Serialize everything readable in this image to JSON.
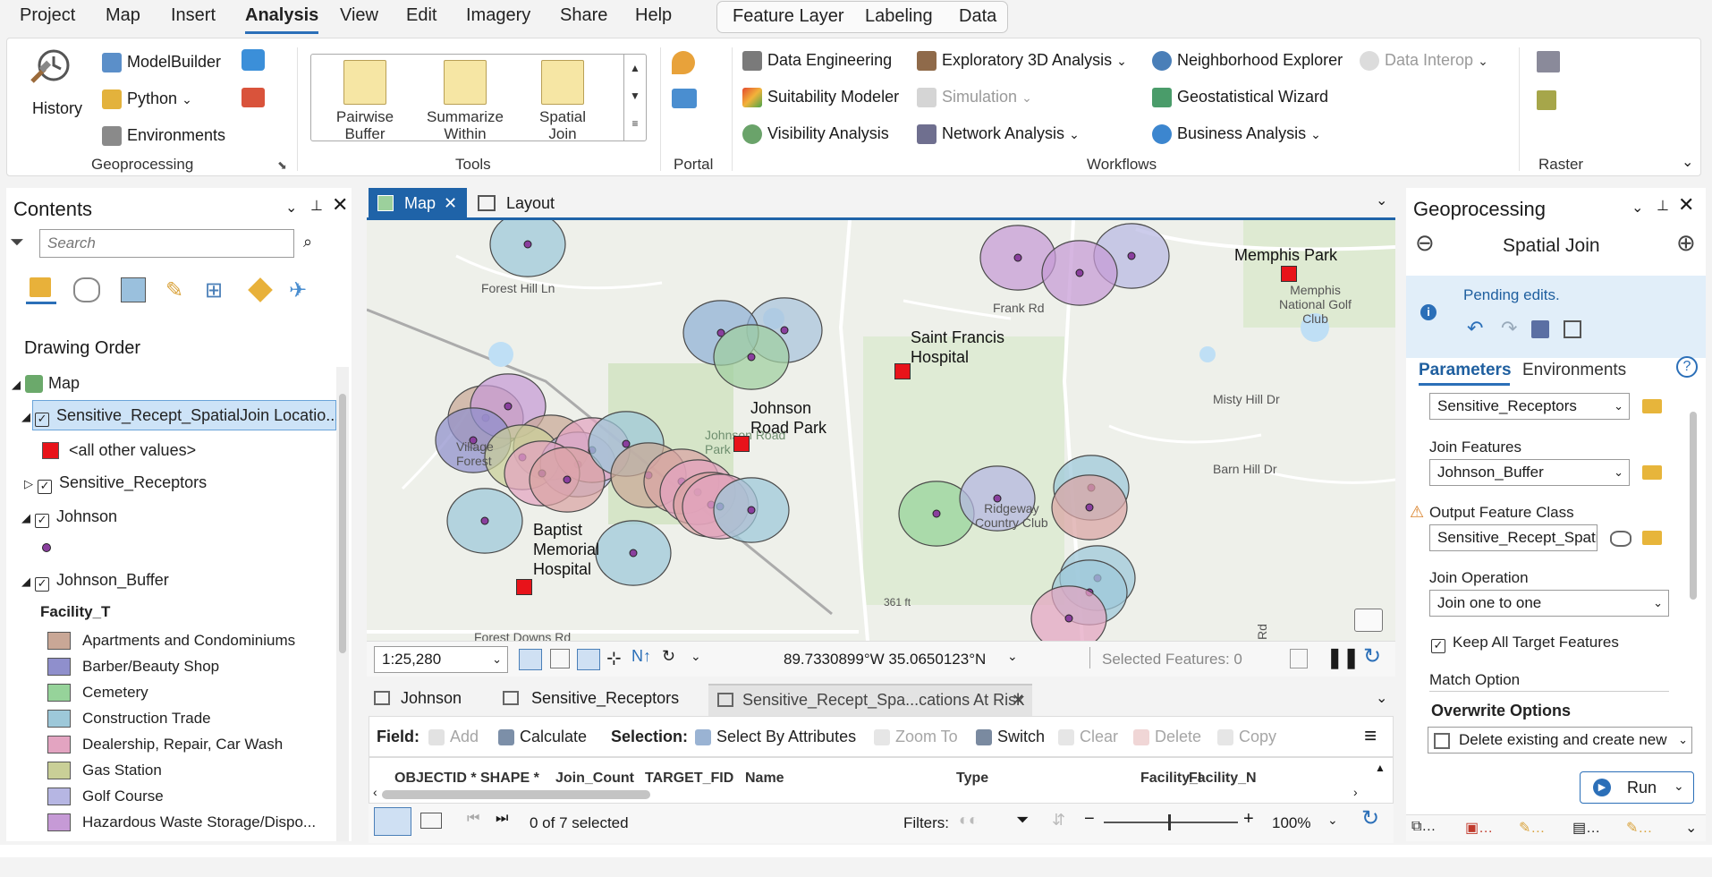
{
  "menu": {
    "tabs": [
      "Project",
      "Map",
      "Insert",
      "Analysis",
      "View",
      "Edit",
      "Imagery",
      "Share",
      "Help"
    ],
    "active": "Analysis",
    "context_tabs": [
      "Feature Layer",
      "Labeling",
      "Data"
    ]
  },
  "ribbon": {
    "history": "History",
    "modelbuilder": "ModelBuilder",
    "python": "Python",
    "environments": "Environments",
    "geoprocessing_group": "Geoprocessing",
    "tools": [
      "Pairwise Buffer",
      "Summarize Within",
      "Spatial Join"
    ],
    "tools_group": "Tools",
    "portal_group": "Portal",
    "workflows": {
      "data_engineering": "Data Engineering",
      "suitability_modeler": "Suitability Modeler",
      "visibility_analysis": "Visibility Analysis",
      "exploratory_3d": "Exploratory 3D Analysis",
      "simulation": "Simulation",
      "network_analysis": "Network Analysis",
      "neighborhood_explorer": "Neighborhood Explorer",
      "geostatistical_wizard": "Geostatistical Wizard",
      "business_analysis": "Business Analysis",
      "data_interop": "Data Interop"
    },
    "workflows_group": "Workflows",
    "raster_group": "Raster"
  },
  "contents": {
    "title": "Contents",
    "search_placeholder": "Search",
    "drawing_order": "Drawing Order",
    "map": "Map",
    "layers": {
      "spatialjoin": "Sensitive_Recept_SpatialJoin Locatio...",
      "all_other": "<all other values>",
      "receptors": "Sensitive_Receptors",
      "johnson": "Johnson",
      "buffer": "Johnson_Buffer",
      "facility_header": "Facility_T"
    },
    "legend": [
      {
        "label": "Apartments and Condominiums",
        "color": "#c9a796"
      },
      {
        "label": "Barber/Beauty Shop",
        "color": "#8f8fcc"
      },
      {
        "label": "Cemetery",
        "color": "#96d39a"
      },
      {
        "label": "Construction Trade",
        "color": "#9dc8d9"
      },
      {
        "label": "Dealership, Repair, Car Wash",
        "color": "#e3a4c1"
      },
      {
        "label": "Gas Station",
        "color": "#c9cf97"
      },
      {
        "label": "Golf Course",
        "color": "#b6b6e3"
      },
      {
        "label": "Hazardous Waste Storage/Dispo...",
        "color": "#c69ad6"
      }
    ]
  },
  "view_tabs": {
    "map": "Map",
    "layout": "Layout"
  },
  "map": {
    "labels": {
      "memphis_park": "Memphis Park",
      "saint_francis": "Saint Francis\nHospital",
      "johnson_park": "Johnson\nRoad Park",
      "baptist": "Baptist\nMemorial\nHospital"
    },
    "roads": {
      "forest_hill": "Forest Hill Ln",
      "frank": "Frank Rd",
      "misty": "Misty Hill Dr",
      "barn": "Barn Hill Dr",
      "forest_downs": "Forest Downs Rd",
      "golf_club": "Memphis\nNational Golf\nClub",
      "ridgeway": "Ridgeway\nCountry Club",
      "village": "Village\nForest",
      "johnson_road": "Johnson Road\nPark",
      "elev": "361 ft",
      "rd": "Rd"
    },
    "scale": "1:25,280",
    "coords": "89.7330899°W 35.0650123°N",
    "selected_features": "Selected Features: 0"
  },
  "table": {
    "tabs": [
      "Johnson",
      "Sensitive_Receptors",
      "Sensitive_Recept_Spa...cations At Risk"
    ],
    "field_label": "Field:",
    "add": "Add",
    "calculate": "Calculate",
    "selection_label": "Selection:",
    "select_by_attributes": "Select By Attributes",
    "zoom_to": "Zoom To",
    "switch": "Switch",
    "clear": "Clear",
    "delete": "Delete",
    "copy": "Copy",
    "columns": [
      "OBJECTID *",
      "SHAPE *",
      "Join_Count",
      "TARGET_FID",
      "Name",
      "Type",
      "Facility_I",
      "Facility_N"
    ],
    "selected": "0 of 7 selected",
    "filters": "Filters:",
    "zoom": "100%"
  },
  "geoprocessing": {
    "title": "Geoprocessing",
    "tool": "Spatial Join",
    "pending": "Pending edits.",
    "tab_parameters": "Parameters",
    "tab_environments": "Environments",
    "target_value": "Sensitive_Receptors",
    "join_features_label": "Join Features",
    "join_features_value": "Johnson_Buffer",
    "output_label": "Output Feature Class",
    "output_value": "Sensitive_Recept_Spati",
    "join_op_label": "Join Operation",
    "join_op_value": "Join one to one",
    "keep_all": "Keep All Target Features",
    "match_option": "Match Option",
    "overwrite": "Overwrite Options",
    "overwrite_value": "Delete existing and create new",
    "run": "Run"
  }
}
